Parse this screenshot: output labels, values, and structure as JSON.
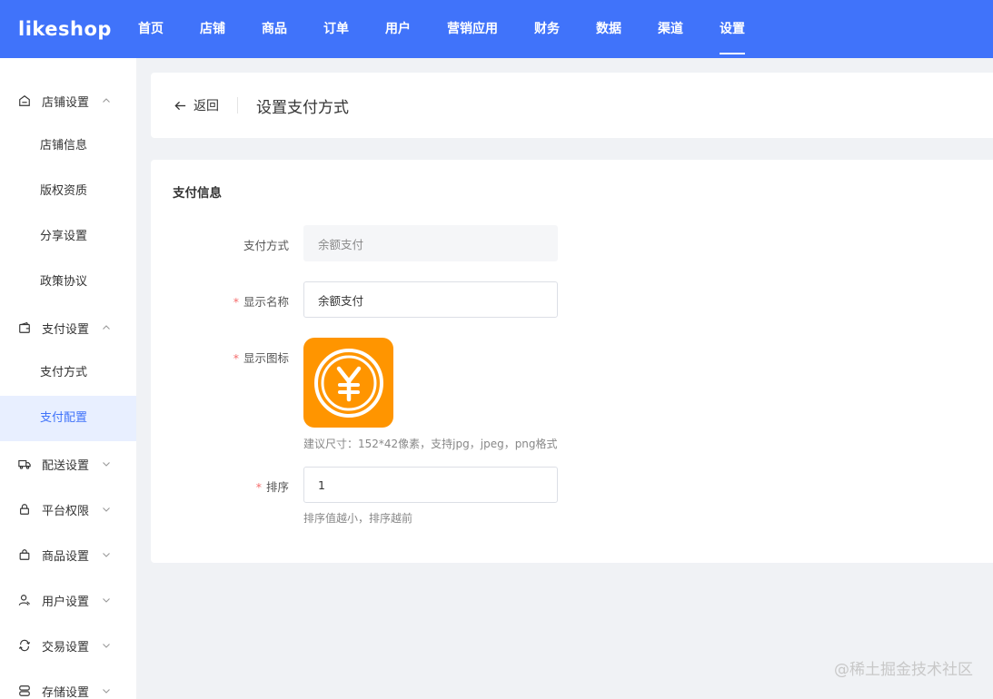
{
  "brand": {
    "logo_text": "likeshop",
    "primary": "#4073fa"
  },
  "topnav": {
    "items": [
      {
        "label": "首页"
      },
      {
        "label": "店铺"
      },
      {
        "label": "商品"
      },
      {
        "label": "订单"
      },
      {
        "label": "用户"
      },
      {
        "label": "营销应用"
      },
      {
        "label": "财务"
      },
      {
        "label": "数据"
      },
      {
        "label": "渠道"
      },
      {
        "label": "设置",
        "active": true
      }
    ]
  },
  "sidebar": {
    "groups": [
      {
        "label": "店铺设置",
        "icon": "store-icon",
        "expanded": true,
        "items": [
          "店铺信息",
          "版权资质",
          "分享设置",
          "政策协议"
        ]
      },
      {
        "label": "支付设置",
        "icon": "wallet-icon",
        "expanded": true,
        "items": [
          "支付方式",
          "支付配置"
        ],
        "active_item": "支付配置"
      },
      {
        "label": "配送设置",
        "icon": "truck-icon",
        "expanded": false
      },
      {
        "label": "平台权限",
        "icon": "lock-icon",
        "expanded": false
      },
      {
        "label": "商品设置",
        "icon": "bag-icon",
        "expanded": false
      },
      {
        "label": "用户设置",
        "icon": "user-icon",
        "expanded": false
      },
      {
        "label": "交易设置",
        "icon": "exchange-icon",
        "expanded": false
      },
      {
        "label": "存储设置",
        "icon": "storage-icon",
        "expanded": false
      }
    ]
  },
  "header": {
    "back_label": "返回",
    "title": "设置支付方式"
  },
  "form": {
    "section_title": "支付信息",
    "pay_method": {
      "label": "支付方式",
      "value": "余额支付"
    },
    "display_name": {
      "label": "显示名称",
      "value": "余额支付"
    },
    "display_icon": {
      "label": "显示图标",
      "icon": "yuan-coin-icon",
      "tip": "建议尺寸：152*42像素，支持jpg，jpeg，png格式"
    },
    "sort": {
      "label": "排序",
      "value": "1",
      "tip": "排序值越小，排序越前"
    }
  },
  "watermark": "@稀土掘金技术社区"
}
